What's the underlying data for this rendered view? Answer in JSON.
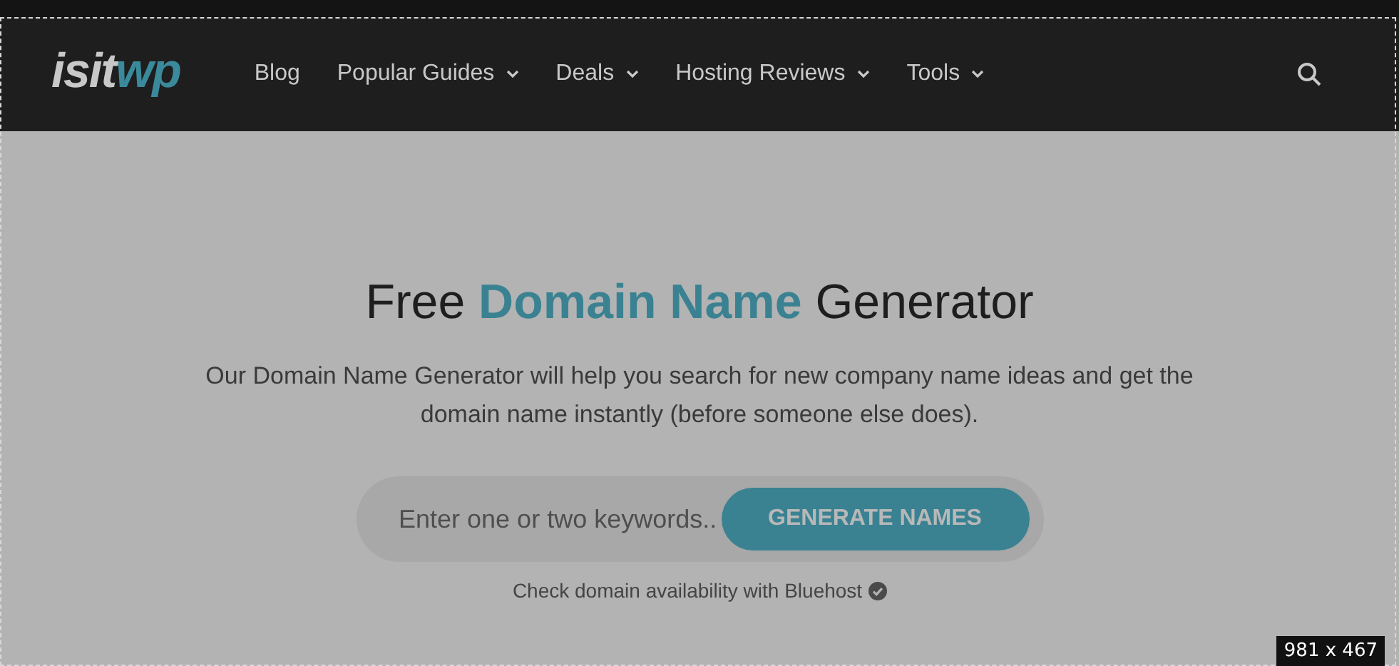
{
  "header": {
    "logo": [
      {
        "text": "isit",
        "highlight": false
      },
      {
        "text": "wp",
        "highlight": true
      }
    ],
    "nav": [
      {
        "label": "Blog",
        "dropdown": false
      },
      {
        "label": "Popular Guides",
        "dropdown": true
      },
      {
        "label": "Deals",
        "dropdown": true
      },
      {
        "label": "Hosting Reviews",
        "dropdown": true
      },
      {
        "label": "Tools",
        "dropdown": true
      }
    ]
  },
  "hero": {
    "heading": [
      {
        "text": "Free ",
        "highlight": false
      },
      {
        "text": "Domain Name",
        "highlight": true
      },
      {
        "text": " Generator",
        "highlight": false
      }
    ],
    "description": "Our Domain Name Generator will help you search for new company name ideas and get the domain name instantly (before someone else does).",
    "search": {
      "placeholder": "Enter one or two keywords..",
      "button": "GENERATE NAMES"
    },
    "note": "Check domain availability with Bluehost"
  },
  "selection_size": "981 x 467"
}
